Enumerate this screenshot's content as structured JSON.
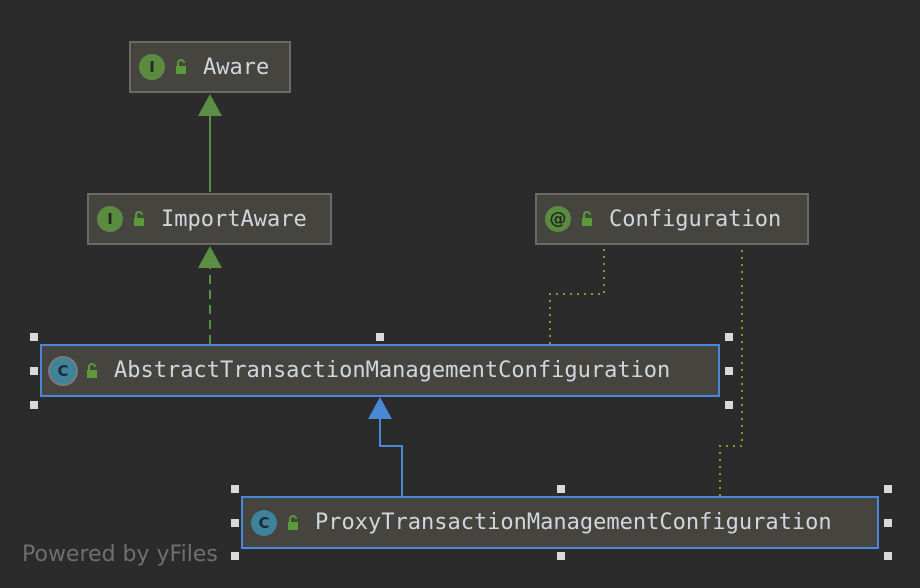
{
  "nodes": {
    "aware": {
      "name": "Aware",
      "kind": "interface",
      "badge": "I"
    },
    "import_aware": {
      "name": "ImportAware",
      "kind": "interface",
      "badge": "I"
    },
    "configuration": {
      "name": "Configuration",
      "kind": "annotation",
      "badge": "@"
    },
    "abstract_config": {
      "name": "AbstractTransactionManagementConfiguration",
      "kind": "abstract class",
      "badge": "C",
      "selected": true
    },
    "proxy_config": {
      "name": "ProxyTransactionManagementConfiguration",
      "kind": "class",
      "badge": "C",
      "selected": true
    }
  },
  "edges": [
    {
      "from": "ImportAware",
      "to": "Aware",
      "style": "solid green",
      "type": "extends"
    },
    {
      "from": "AbstractTransactionManagementConfiguration",
      "to": "ImportAware",
      "style": "dashed green",
      "type": "implements"
    },
    {
      "from": "ProxyTransactionManagementConfiguration",
      "to": "AbstractTransactionManagementConfiguration",
      "style": "solid blue",
      "type": "extends"
    },
    {
      "from": "AbstractTransactionManagementConfiguration",
      "to": "Configuration",
      "style": "dotted olive",
      "type": "annotated-with"
    },
    {
      "from": "ProxyTransactionManagementConfiguration",
      "to": "Configuration",
      "style": "dotted olive",
      "type": "annotated-with"
    }
  ],
  "colors": {
    "background": "#2b2b2b",
    "node_fill": "#45443f",
    "node_border": "#6a6a66",
    "selected_border": "#4a88d6",
    "interface_badge": "#5b8b40",
    "class_badge": "#3e8399",
    "extends_green": "#5a8f45",
    "extends_blue": "#4a88d6",
    "annotation_dotted": "#8a9a2a"
  },
  "watermark": "Powered by yFiles"
}
